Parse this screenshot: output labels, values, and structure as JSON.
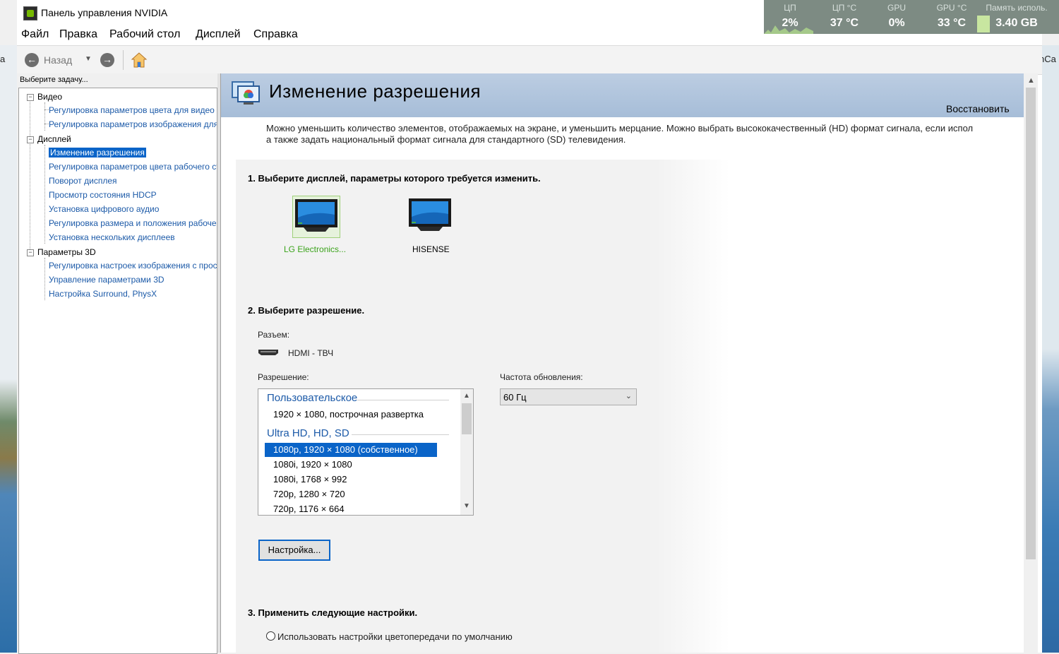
{
  "window": {
    "title": "Панель управления NVIDIA"
  },
  "overlay": {
    "cpu_label": "ЦП",
    "cpu_value": "2%",
    "cpu_temp_label": "ЦП °C",
    "cpu_temp_value": "37 °C",
    "gpu_label": "GPU",
    "gpu_value": "0%",
    "gpu_temp_label": "GPU °C",
    "gpu_temp_value": "33 °C",
    "mem_label": "Память исполь.",
    "mem_value": "3.40 GB"
  },
  "menu": {
    "file": "Файл",
    "edit": "Правка",
    "desktop": "Рабочий стол",
    "display": "Дисплей",
    "help": "Справка"
  },
  "toolbar": {
    "back_label": "Назад"
  },
  "desktop": {
    "right_text": "nCa"
  },
  "sidebar": {
    "task_label": "Выберите задачу...",
    "groups": [
      {
        "label": "Видео",
        "items": [
          "Регулировка параметров цвета для видео",
          "Регулировка параметров изображения для видео"
        ]
      },
      {
        "label": "Дисплей",
        "items": [
          "Изменение разрешения",
          "Регулировка параметров цвета рабочего стола",
          "Поворот дисплея",
          "Просмотр состояния HDCP",
          "Установка цифрового аудио",
          "Регулировка размера и положения рабочего стола",
          "Установка нескольких дисплеев"
        ]
      },
      {
        "label": "Параметры 3D",
        "items": [
          "Регулировка настроек изображения с просмотром",
          "Управление параметрами 3D",
          "Настройка Surround, PhysX"
        ]
      }
    ]
  },
  "main": {
    "title": "Изменение разрешения",
    "restore": "Восстановить",
    "desc_line1": "Можно уменьшить количество элементов, отображаемых на экране, и уменьшить мерцание. Можно выбрать высококачественный (HD) формат сигнала, если испол",
    "desc_line2": "а также задать национальный формат сигнала для стандартного (SD) телевидения.",
    "step1": "1. Выберите дисплей, параметры которого требуется изменить.",
    "displays": [
      "LG Electronics...",
      "HISENSE"
    ],
    "step2": "2. Выберите разрешение.",
    "connector_label": "Разъем:",
    "connector_value": "HDMI - ТВЧ",
    "resolution_label": "Разрешение:",
    "refresh_label": "Частота обновления:",
    "refresh_value": "60 Гц",
    "res_groups": [
      "Пользовательское",
      "Ultra HD, HD, SD"
    ],
    "res_items": [
      "1920 × 1080, построчная развертка",
      "1080p, 1920 × 1080 (собственное)",
      "1080i, 1920 × 1080",
      "1080i, 1768 × 992",
      "720p, 1280 × 720",
      "720p, 1176 × 664"
    ],
    "customize_button": "Настройка...",
    "step3": "3. Применить следующие настройки.",
    "radio_default": "Использовать настройки цветопередачи по умолчанию"
  },
  "colors": {
    "accent": "#0a64c8",
    "link": "#1c5aa8",
    "header": "#a6bdd8",
    "selected_display": "#3aa31a"
  }
}
